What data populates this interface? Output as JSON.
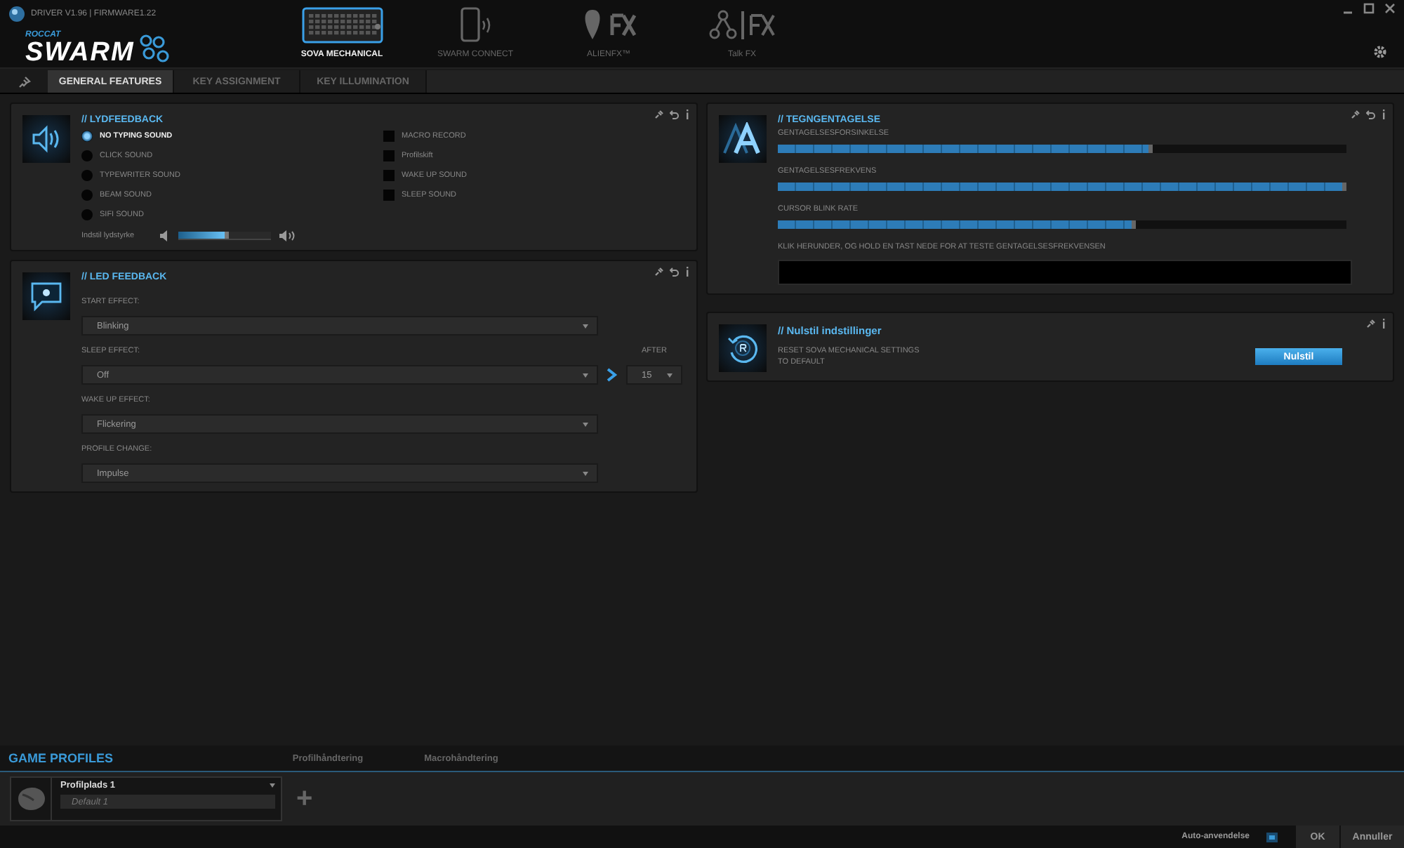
{
  "window": {
    "version": "DRIVER V1.96 | FIRMWARE1.22",
    "brand_top": "ROCCAT",
    "brand": "SWARM"
  },
  "devices": [
    {
      "kind": "keyboard",
      "label": "SOVA MECHANICAL",
      "selected": true
    },
    {
      "kind": "phone",
      "label": "SWARM CONNECT",
      "selected": false
    },
    {
      "kind": "alien",
      "label": "ALIENFX™",
      "selected": false
    },
    {
      "kind": "talk",
      "label": "Talk FX",
      "selected": false
    }
  ],
  "tabs": [
    {
      "label": "GENERAL FEATURES",
      "selected": true
    },
    {
      "label": "KEY ASSIGNMENT",
      "selected": false
    },
    {
      "label": "KEY ILLUMINATION",
      "selected": false
    }
  ],
  "sound_feedback": {
    "title": "// LYDFEEDBACK",
    "sounds": [
      {
        "label": "NO TYPING SOUND",
        "selected": true
      },
      {
        "label": "CLICK SOUND",
        "selected": false
      },
      {
        "label": "TYPEWRITER SOUND",
        "selected": false
      },
      {
        "label": "BEAM SOUND",
        "selected": false
      },
      {
        "label": "SIFI SOUND",
        "selected": false
      }
    ],
    "options": [
      {
        "label": "MACRO RECORD",
        "checked": false
      },
      {
        "label": "Profilskift",
        "checked": false
      },
      {
        "label": "WAKE UP SOUND",
        "checked": false
      },
      {
        "label": "SLEEP SOUND",
        "checked": false
      }
    ],
    "volume": {
      "label": "Indstil lydstyrke",
      "level": 0.55
    }
  },
  "led_feedback": {
    "title": "// LED FEEDBACK",
    "fields": [
      {
        "label": "START EFFECT:",
        "value": "Blinking"
      },
      {
        "label": "SLEEP EFFECT:",
        "value": "Off",
        "after": {
          "label": "AFTER",
          "value": "15"
        }
      },
      {
        "label": "WAKE UP EFFECT:",
        "value": "Flickering"
      },
      {
        "label": "PROFILE CHANGE:",
        "value": "Impulse"
      }
    ]
  },
  "character_repeat": {
    "title": "// TEGNGENTAGELSE",
    "sliders": [
      {
        "label": "GENTAGELSESFORSINKELSE",
        "level": 0.66
      },
      {
        "label": "GENTAGELSESFREKVENS",
        "level": 1.0
      },
      {
        "label": "CURSOR BLINK RATE",
        "level": 0.63
      }
    ],
    "test_label": "KLIK HERUNDER, OG HOLD EN TAST NEDE FOR AT TESTE GENTAGELSESFREKVENSEN"
  },
  "reset": {
    "title": "// Nulstil indstillinger",
    "description": [
      "RESET SOVA MECHANICAL SETTINGS",
      "TO DEFAULT"
    ],
    "button": "Nulstil"
  },
  "game_profiles": {
    "title": "GAME PROFILES",
    "tabs": [
      "Profilhåndtering",
      "Macrohåndtering"
    ],
    "profile": {
      "name": "Profilplads 1",
      "value": "Default 1"
    },
    "add": "+"
  },
  "footer": {
    "auto_apply": {
      "label": "Auto-anvendelse",
      "on": true
    },
    "buttons": [
      "OK",
      "Annuller"
    ]
  }
}
